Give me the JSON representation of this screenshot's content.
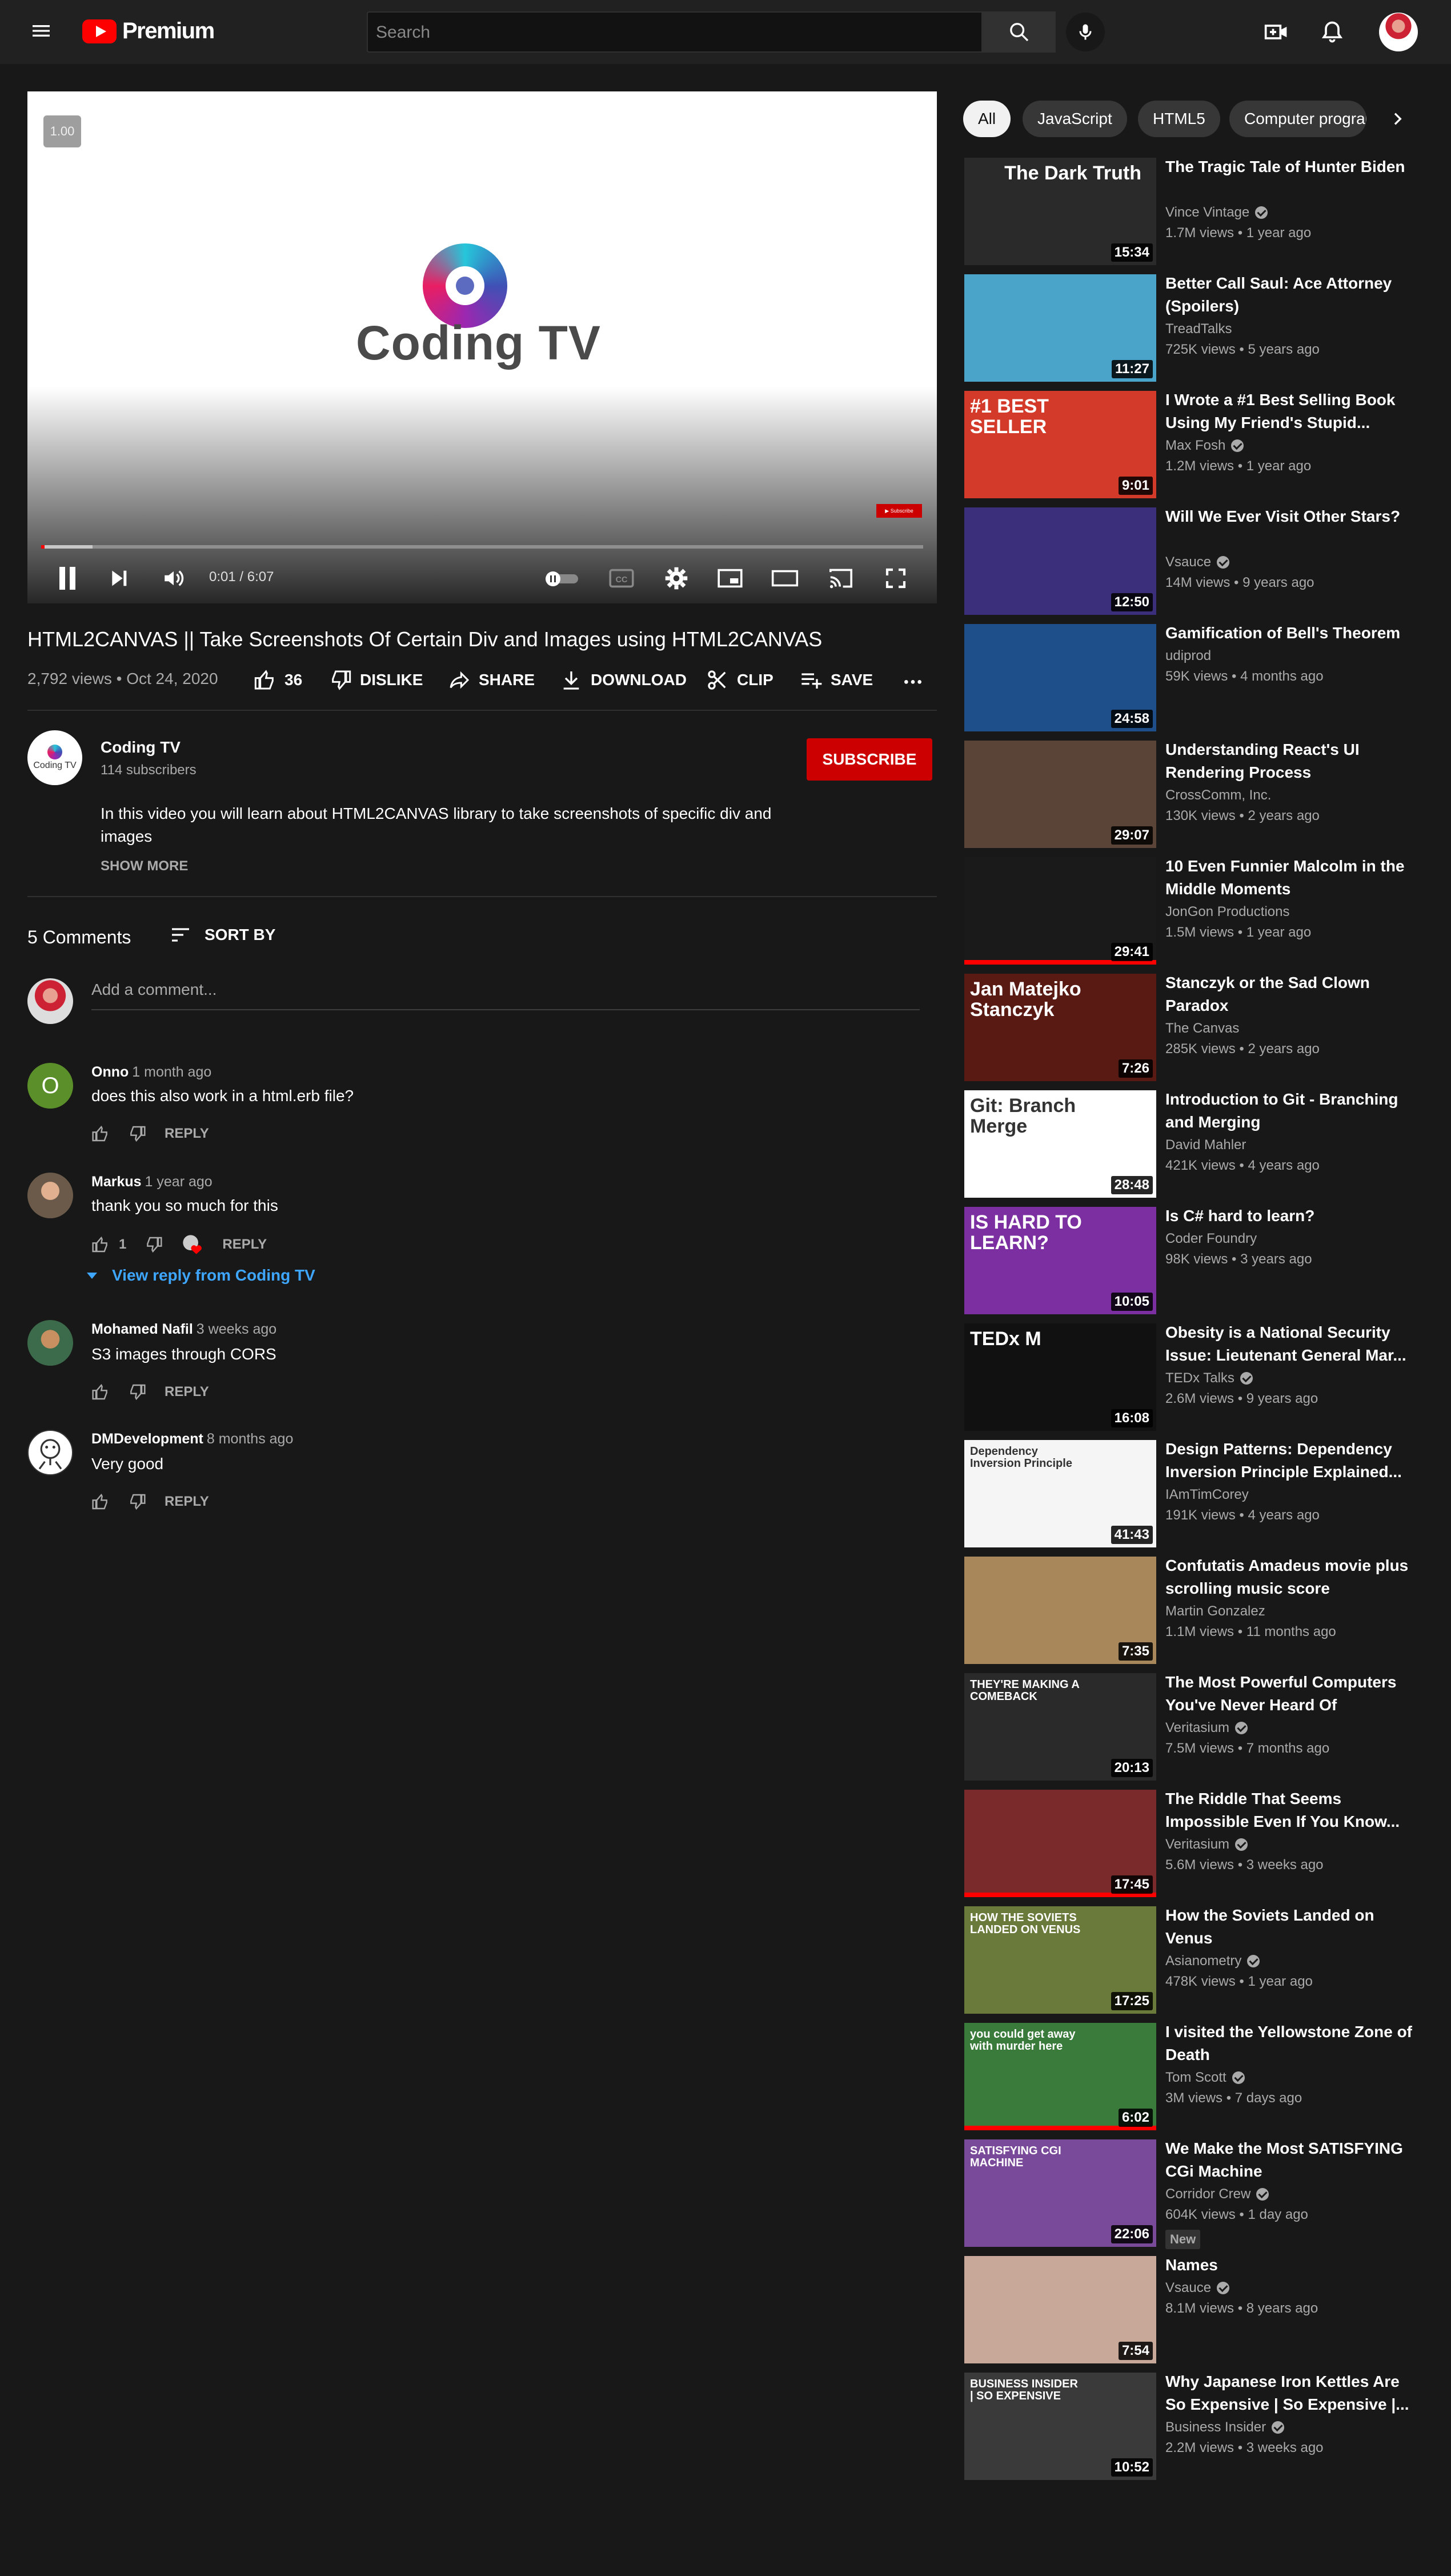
{
  "header": {
    "logo_text": "Premium",
    "search_placeholder": "Search"
  },
  "player": {
    "speed": "1.00",
    "brand_text": "Coding TV",
    "time": "0:01 / 6:07",
    "progress": 0.003,
    "accent": "#ff0000"
  },
  "video": {
    "title": "HTML2CANVAS || Take Screenshots Of Certain Div and Images using HTML2CANVAS",
    "meta": "2,792 views • Oct 24, 2020",
    "likes": "36",
    "dislike_label": "DISLIKE",
    "share_label": "SHARE",
    "download_label": "DOWNLOAD",
    "clip_label": "CLIP",
    "save_label": "SAVE"
  },
  "channel": {
    "name": "Coding TV",
    "subscribers": "114 subscribers",
    "avatar_text": "Coding TV",
    "subscribe_label": "SUBSCRIBE",
    "description": "In this video you will learn about HTML2CANVAS library to take screenshots of specific div and images",
    "show_more": "SHOW MORE"
  },
  "comments": {
    "count_label": "5 Comments",
    "sort_label": "SORT BY",
    "add_placeholder": "Add a comment...",
    "reply_label": "REPLY",
    "view_reply": "View reply from Coding TV",
    "items": [
      {
        "author": "Onno",
        "time": "1 month ago",
        "text": "does this also work in a html.erb file?",
        "likes": "",
        "avatar_letter": "O",
        "avatar_color": "#5a8f29"
      },
      {
        "author": "Markus",
        "time": "1 year ago",
        "text": "thank you so much for this",
        "likes": "1",
        "avatar_letter": "",
        "avatar_color": "#6b5a4a"
      },
      {
        "author": "Mohamed Nafil",
        "time": "3 weeks ago",
        "text": "S3 images through CORS",
        "likes": "",
        "avatar_letter": "",
        "avatar_color": "#3b6b4b"
      },
      {
        "author": "DMDevelopment",
        "time": "8 months ago",
        "text": "Very good",
        "likes": "",
        "avatar_letter": "",
        "avatar_color": "#ffffff"
      }
    ]
  },
  "chips": [
    "All",
    "JavaScript",
    "HTML5",
    "Computer programming"
  ],
  "related": [
    {
      "title": "The Tragic Tale of Hunter Biden",
      "channel": "Vince Vintage",
      "verified": true,
      "meta": "1.7M views • 1 year ago",
      "duration": "15:34",
      "thumb_text": "The Dark Truth",
      "bg": "#2a2a2a"
    },
    {
      "title": "Better Call Saul: Ace Attorney (Spoilers)",
      "channel": "TreadTalks",
      "verified": false,
      "meta": "725K views • 5 years ago",
      "duration": "11:27",
      "thumb_text": "",
      "bg": "#4aa3c9"
    },
    {
      "title": "I Wrote a #1 Best Selling Book Using My Friend's Stupid...",
      "channel": "Max Fosh",
      "verified": true,
      "meta": "1.2M views • 1 year ago",
      "duration": "9:01",
      "thumb_text": "#1 BEST SELLER",
      "bg": "#d43a2a"
    },
    {
      "title": "Will We Ever Visit Other Stars?",
      "channel": "Vsauce",
      "verified": true,
      "meta": "14M views • 9 years ago",
      "duration": "12:50",
      "thumb_text": "",
      "bg": "#3b2e7a"
    },
    {
      "title": "Gamification of Bell's Theorem",
      "channel": "udiprod",
      "verified": false,
      "meta": "59K views • 4 months ago",
      "duration": "24:58",
      "thumb_text": "",
      "bg": "#1e4f8a"
    },
    {
      "title": "Understanding React's UI Rendering Process",
      "channel": "CrossComm, Inc.",
      "verified": false,
      "meta": "130K views • 2 years ago",
      "duration": "29:07",
      "thumb_text": "",
      "bg": "#5a4438"
    },
    {
      "title": "10 Even Funnier Malcolm in the Middle Moments",
      "channel": "JonGon Productions",
      "verified": false,
      "meta": "1.5M views • 1 year ago",
      "duration": "29:41",
      "thumb_text": "",
      "bg": "#1a1a1a",
      "watched": 1.0
    },
    {
      "title": "Stanczyk or the Sad Clown Paradox",
      "channel": "The Canvas",
      "verified": false,
      "meta": "285K views • 2 years ago",
      "duration": "7:26",
      "thumb_text": "Jan Matejko Stanczyk",
      "bg": "#5a1a14"
    },
    {
      "title": "Introduction to Git - Branching and Merging",
      "channel": "David Mahler",
      "verified": false,
      "meta": "421K views • 4 years ago",
      "duration": "28:48",
      "thumb_text": "Git: Branch Merge",
      "bg": "#ffffff"
    },
    {
      "title": "Is C# hard to learn?",
      "channel": "Coder Foundry",
      "verified": false,
      "meta": "98K views • 3 years ago",
      "duration": "10:05",
      "thumb_text": "IS HARD TO LEARN?",
      "bg": "#7b2fa0"
    },
    {
      "title": "Obesity is a National Security Issue: Lieutenant General Mar...",
      "channel": "TEDx Talks",
      "verified": true,
      "meta": "2.6M views • 9 years ago",
      "duration": "16:08",
      "thumb_text": "TEDx M",
      "bg": "#111111"
    },
    {
      "title": "Design Patterns: Dependency Inversion Principle Explained...",
      "channel": "IAmTimCorey",
      "verified": false,
      "meta": "191K views • 4 years ago",
      "duration": "41:43",
      "thumb_text": "Dependency Inversion Principle",
      "bg": "#f5f5f5"
    },
    {
      "title": "Confutatis Amadeus movie plus scrolling music score",
      "channel": "Martin Gonzalez",
      "verified": false,
      "meta": "1.1M views • 11 months ago",
      "duration": "7:35",
      "thumb_text": "",
      "bg": "#a8885a"
    },
    {
      "title": "The Most Powerful Computers You've Never Heard Of",
      "channel": "Veritasium",
      "verified": true,
      "meta": "7.5M views • 7 months ago",
      "duration": "20:13",
      "thumb_text": "THEY'RE MAKING A COMEBACK",
      "bg": "#2a2a2a"
    },
    {
      "title": "The Riddle That Seems Impossible Even If You Know...",
      "channel": "Veritasium",
      "verified": true,
      "meta": "5.6M views • 3 weeks ago",
      "duration": "17:45",
      "thumb_text": "",
      "bg": "#7a2a2a",
      "watched": 1.0
    },
    {
      "title": "How the Soviets Landed on Venus",
      "channel": "Asianometry",
      "verified": true,
      "meta": "478K views • 1 year ago",
      "duration": "17:25",
      "thumb_text": "HOW THE SOVIETS LANDED ON VENUS",
      "bg": "#6a7a3a"
    },
    {
      "title": "I visited the Yellowstone Zone of Death",
      "channel": "Tom Scott",
      "verified": true,
      "meta": "3M views • 7 days ago",
      "duration": "6:02",
      "thumb_text": "you could get away with murder here",
      "bg": "#3a7a3a",
      "watched": 1.0
    },
    {
      "title": "We Make the Most SATISFYING CGi Machine",
      "channel": "Corridor Crew",
      "verified": true,
      "meta": "604K views • 1 day ago",
      "duration": "22:06",
      "thumb_text": "SATISFYING CGI MACHINE",
      "bg": "#7a4a9a",
      "badge": "New"
    },
    {
      "title": "Names",
      "channel": "Vsauce",
      "verified": true,
      "meta": "8.1M views • 8 years ago",
      "duration": "7:54",
      "thumb_text": "",
      "bg": "#c8a898"
    },
    {
      "title": "Why Japanese Iron Kettles Are So Expensive | So Expensive |...",
      "channel": "Business Insider",
      "verified": true,
      "meta": "2.2M views • 3 weeks ago",
      "duration": "10:52",
      "thumb_text": "BUSINESS INSIDER | SO EXPENSIVE",
      "bg": "#3a3a3a"
    }
  ]
}
